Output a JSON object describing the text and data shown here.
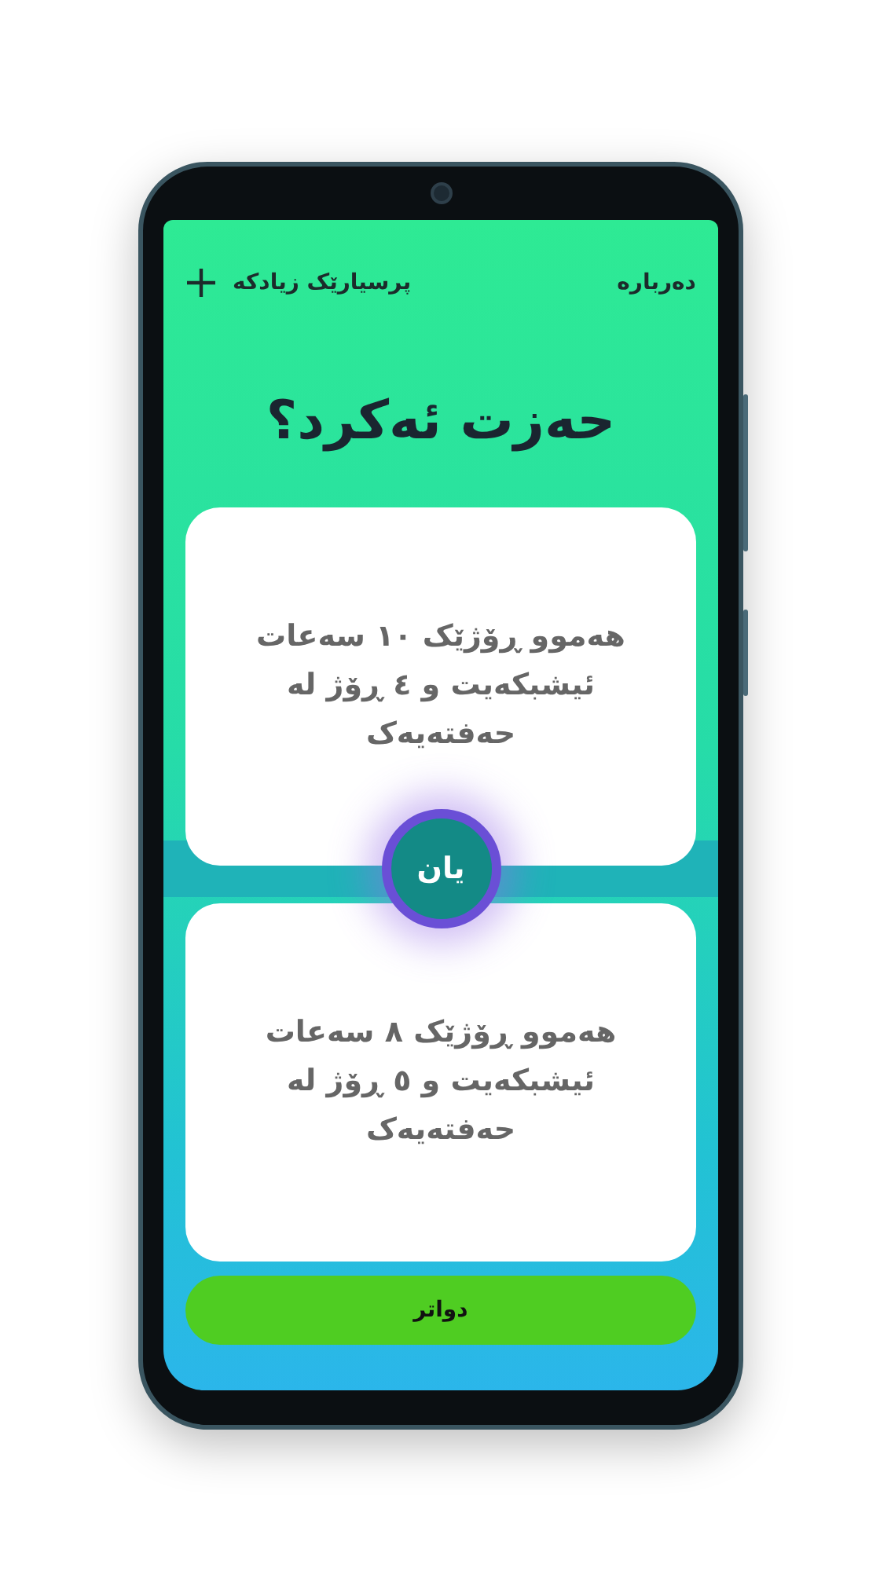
{
  "header": {
    "about_link": "دەربارە",
    "add_question_button": "پرسیارێک زیادکە"
  },
  "question": "حەزت ئەکرد؟",
  "options": [
    {
      "text": "هەموو ڕۆژێک ١٠ سەعات ئیشبکەیت و ٤ ڕۆژ لە حەفتەیەک"
    },
    {
      "text": "هەموو ڕۆژێک ٨ سەعات ئیشبکەیت و ٥ ڕۆژ لە حەفتەیەک"
    }
  ],
  "separator": "یان",
  "next_button": "دواتر"
}
